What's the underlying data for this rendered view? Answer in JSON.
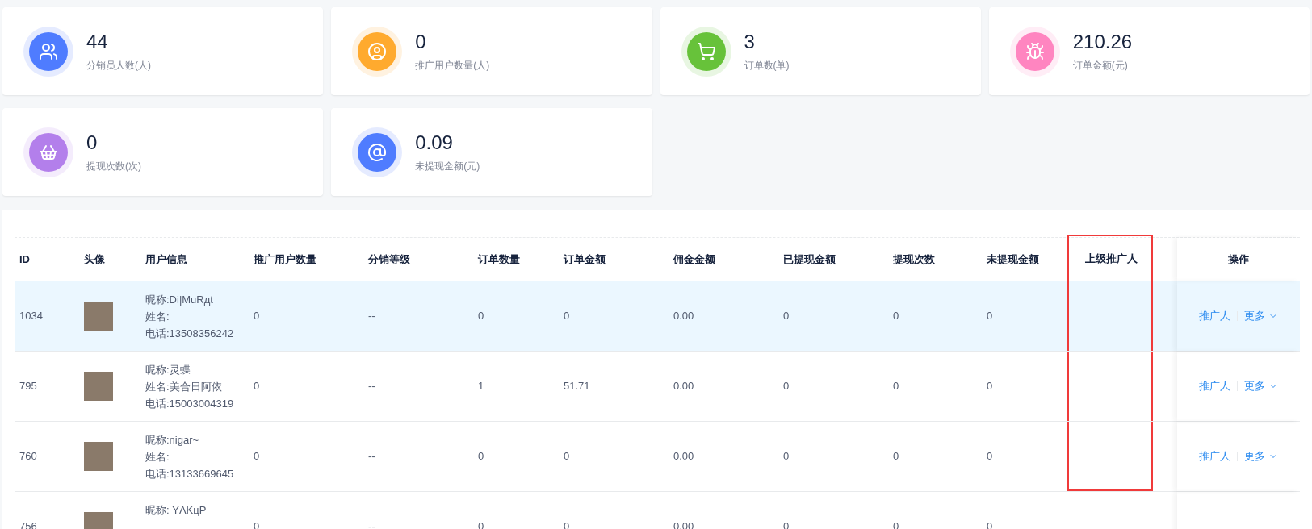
{
  "stats": [
    {
      "value": "44",
      "label": "分销员人数(人)",
      "color": "#4f7cff"
    },
    {
      "value": "0",
      "label": "推广用户数量(人)",
      "color": "#ffaa2e"
    },
    {
      "value": "3",
      "label": "订单数(单)",
      "color": "#67c23a"
    },
    {
      "value": "210.26",
      "label": "订单金额(元)",
      "color": "#ff85c0"
    },
    {
      "value": "0",
      "label": "提现次数(次)",
      "color": "#b37feb"
    },
    {
      "value": "0.09",
      "label": "未提现金额(元)",
      "color": "#4f7cff"
    }
  ],
  "table": {
    "columns": [
      {
        "label": "ID",
        "highlighted": false
      },
      {
        "label": "头像",
        "highlighted": false
      },
      {
        "label": "用户信息",
        "highlighted": false
      },
      {
        "label": "推广用户数量",
        "highlighted": false
      },
      {
        "label": "分销等级",
        "highlighted": false
      },
      {
        "label": "订单数量",
        "highlighted": false
      },
      {
        "label": "订单金额",
        "highlighted": false
      },
      {
        "label": "佣金金额",
        "highlighted": false
      },
      {
        "label": "已提现金额",
        "highlighted": false
      },
      {
        "label": "提现次数",
        "highlighted": false
      },
      {
        "label": "未提现金额",
        "highlighted": false
      },
      {
        "label": "上级推广人",
        "highlighted": true
      },
      {
        "label": "操作",
        "highlighted": false
      }
    ],
    "rows": [
      {
        "selected": true,
        "id": "1034",
        "info": [
          "昵称:Di|MuRдt",
          "姓名:",
          "电话:13508356242"
        ],
        "promoted": "0",
        "level": "--",
        "orders": "0",
        "order_amount": "0",
        "commission": "0.00",
        "withdrawn": "0",
        "withdraw_count": "0",
        "unwithdrawn": "0",
        "actions": [
          "推广人",
          "更多"
        ]
      },
      {
        "selected": false,
        "id": "795",
        "info": [
          "昵称:灵蝶",
          "姓名:美合日阿依",
          "电话:15003004319"
        ],
        "promoted": "0",
        "level": "--",
        "orders": "1",
        "order_amount": "51.71",
        "commission": "0.00",
        "withdrawn": "0",
        "withdraw_count": "0",
        "unwithdrawn": "0",
        "actions": [
          "推广人",
          "更多"
        ]
      },
      {
        "selected": false,
        "id": "760",
        "info": [
          "昵称:nigar~",
          "姓名:",
          "电话:13133669645"
        ],
        "promoted": "0",
        "level": "--",
        "orders": "0",
        "order_amount": "0",
        "commission": "0.00",
        "withdrawn": "0",
        "withdraw_count": "0",
        "unwithdrawn": "0",
        "actions": [
          "推广人",
          "更多"
        ]
      },
      {
        "selected": false,
        "id": "756",
        "info": [
          "昵称: YΛKцP"
        ],
        "promoted": "0",
        "level": "--",
        "orders": "0",
        "order_amount": "0",
        "commission": "0.00",
        "withdrawn": "0",
        "withdraw_count": "0",
        "unwithdrawn": "0"
      }
    ]
  }
}
